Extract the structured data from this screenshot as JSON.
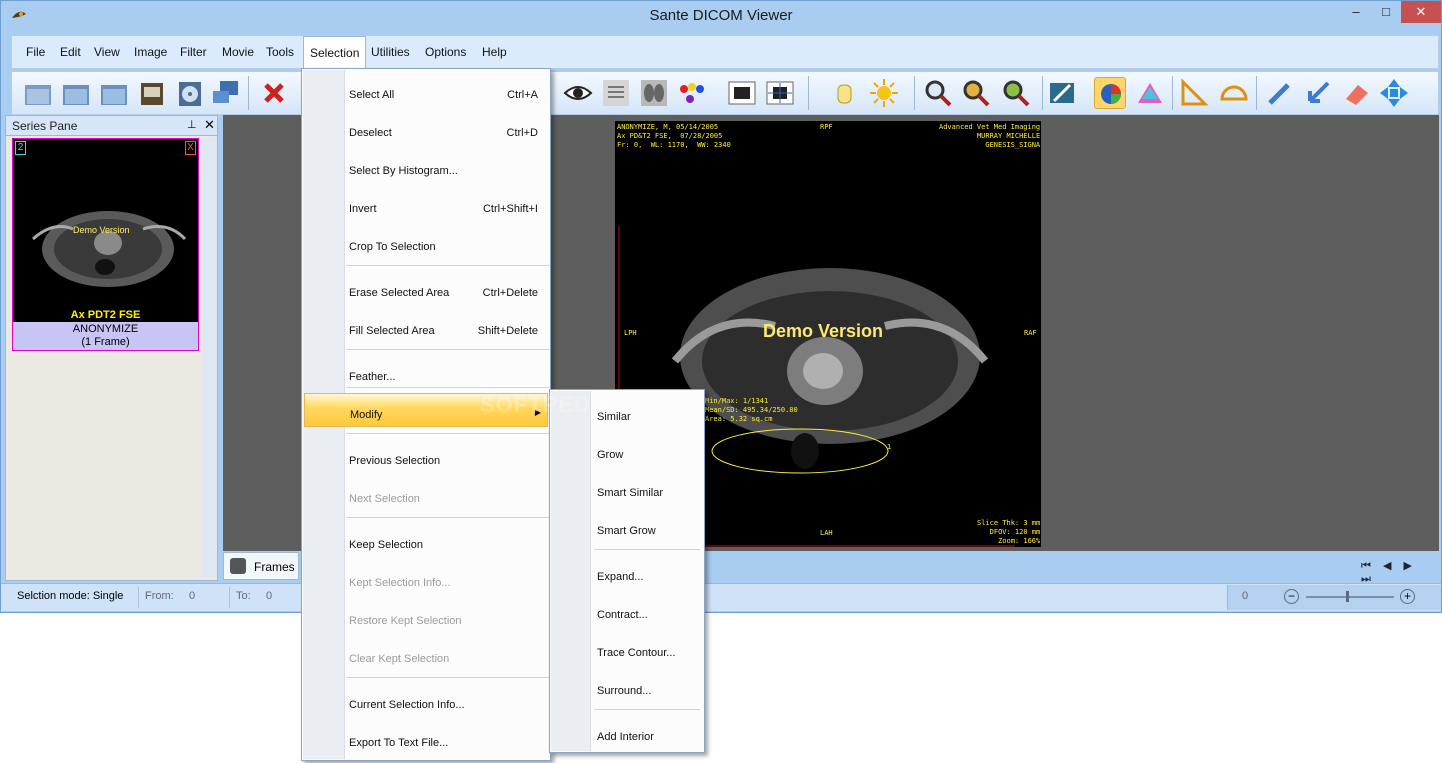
{
  "window": {
    "title": "Sante DICOM Viewer",
    "minimize": "–",
    "maximize": "□",
    "close": "✕"
  },
  "menubar": [
    "File",
    "Edit",
    "View",
    "Image",
    "Filter",
    "Movie",
    "Tools",
    "Selection",
    "Utilities",
    "Options",
    "Help"
  ],
  "toolbar_icons": [
    "open-folder-icon",
    "folder-icon",
    "folder-icon",
    "scanner-icon",
    "cd-icon",
    "network-icon",
    "delete-icon",
    "eye-icon",
    "xray-chest-icon",
    "xray-lung-icon",
    "color-palette-icon",
    "window-icon",
    "crosshair-icon",
    "hand-icon",
    "brightness-icon",
    "magnifier-icon",
    "zoom-region-icon",
    "zoom-fit-icon",
    "pen-icon",
    "roi-color-icon",
    "palette-icon",
    "triangle-ruler-icon",
    "protractor-icon",
    "pencil-icon",
    "arrow-icon",
    "eraser-icon",
    "move-icon"
  ],
  "series_pane": {
    "title": "Series Pane",
    "pin": "⊥",
    "close": "✕",
    "thumb_number": "2",
    "thumb_close": "X",
    "thumb_demo": "Demo Version",
    "thumb_caption": "Ax PDT2 FSE",
    "thumb_patient": "ANONYMIZE",
    "thumb_frames": "(1 Frame)"
  },
  "viewer": {
    "top_left": "ANONYMIZE, M, 05/14/2005\nAx PD&T2 FSE,  07/28/2005\nFr: 0,  WL: 1170,  WW: 2340",
    "top_center": "RPF",
    "top_right": "Advanced Vet Med Imaging\nMURRAY MICHELLE\nGENESIS_SIGNA",
    "left_center": "LPH",
    "right_center": "RAF",
    "bottom_center": "LAH",
    "bottom_right": "Slice Thk: 3 mm\nDFOV: 120 mm\nZoom: 166%",
    "roi_stats": "Min/Max: 1/1341\nMean/SD: 495.34/250.80\nArea: 5.32 sq.cm",
    "roi_label": "1",
    "demo": "Demo Version",
    "watermark": "SOFTPEDIA"
  },
  "bottom_tabs": {
    "frames": "Frames",
    "nav": [
      "⏮",
      "◀",
      "▶",
      "⏭"
    ]
  },
  "statusbar": {
    "mode": "Selction mode: Single",
    "from_label": "From:",
    "from_value": "0",
    "to_label": "To:",
    "to_value": "0",
    "zoom_value": "0",
    "zoom_minus": "−",
    "zoom_plus": "+"
  },
  "selection_menu": [
    {
      "label": "Select All",
      "shortcut": "Ctrl+A"
    },
    {
      "label": "Deselect",
      "shortcut": "Ctrl+D"
    },
    {
      "label": "Select By Histogram...",
      "shortcut": ""
    },
    {
      "label": "Invert",
      "shortcut": "Ctrl+Shift+I"
    },
    {
      "label": "Crop To Selection",
      "shortcut": ""
    },
    {
      "label": "Erase Selected Area",
      "shortcut": "Ctrl+Delete"
    },
    {
      "label": "Fill Selected Area",
      "shortcut": "Shift+Delete"
    },
    {
      "label": "Feather...",
      "shortcut": ""
    },
    {
      "label": "Modify",
      "shortcut": ""
    },
    {
      "label": "Previous Selection",
      "shortcut": ""
    },
    {
      "label": "Next Selection",
      "shortcut": ""
    },
    {
      "label": "Keep Selection",
      "shortcut": ""
    },
    {
      "label": "Kept Selection Info...",
      "shortcut": ""
    },
    {
      "label": "Restore Kept Selection",
      "shortcut": ""
    },
    {
      "label": "Clear Kept Selection",
      "shortcut": ""
    },
    {
      "label": "Current Selection Info...",
      "shortcut": ""
    },
    {
      "label": "Export To Text File...",
      "shortcut": ""
    }
  ],
  "modify_submenu": [
    "Similar",
    "Grow",
    "Smart Similar",
    "Smart Grow",
    "Expand...",
    "Contract...",
    "Trace Contour...",
    "Surround...",
    "Add Interior"
  ]
}
